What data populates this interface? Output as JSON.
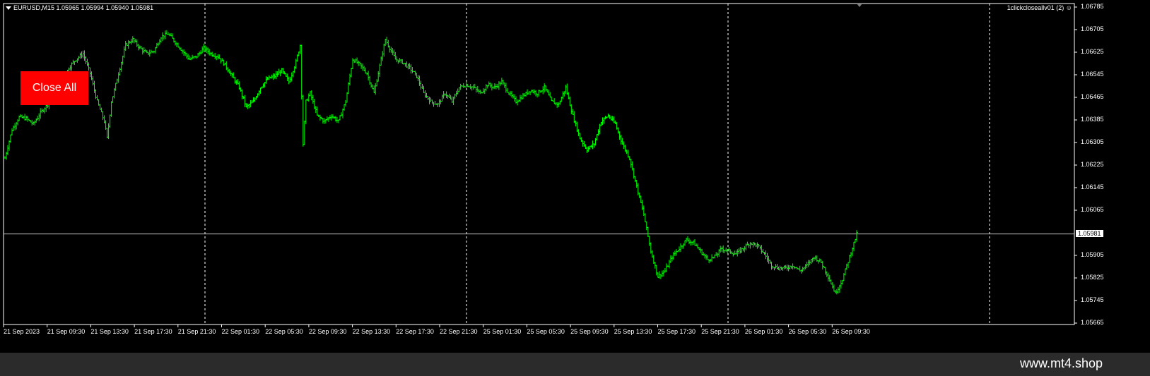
{
  "header": {
    "symbol_info": "EURUSD,M15  1.05965 1.05994 1.05940 1.05981",
    "ea_label": "1clickcloseallv01 (2) ☺"
  },
  "button": {
    "close_all_label": "Close All"
  },
  "price_axis": {
    "labels": [
      "1.06785",
      "1.06705",
      "1.06625",
      "1.06545",
      "1.06465",
      "1.06385",
      "1.06305",
      "1.06225",
      "1.06145",
      "1.06065",
      "1.05905",
      "1.05825",
      "1.05745",
      "1.05665"
    ],
    "current_price": "1.05981"
  },
  "time_axis": {
    "labels": [
      "21 Sep 2023",
      "21 Sep 09:30",
      "21 Sep 13:30",
      "21 Sep 17:30",
      "21 Sep 21:30",
      "22 Sep 01:30",
      "22 Sep 05:30",
      "22 Sep 09:30",
      "22 Sep 13:30",
      "22 Sep 17:30",
      "22 Sep 21:30",
      "25 Sep 01:30",
      "25 Sep 05:30",
      "25 Sep 09:30",
      "25 Sep 13:30",
      "25 Sep 17:30",
      "25 Sep 21:30",
      "26 Sep 01:30",
      "26 Sep 05:30",
      "26 Sep 09:30"
    ]
  },
  "chart_data": {
    "type": "bar",
    "symbol": "EURUSD",
    "timeframe": "M15",
    "ylim": [
      1.05665,
      1.06785
    ],
    "bar_color": "#00ff00",
    "background": "#000000",
    "close_path": [
      [
        0,
        1.0625
      ],
      [
        5,
        1.0635
      ],
      [
        10,
        1.06395
      ],
      [
        15,
        1.0639
      ],
      [
        20,
        1.0637
      ],
      [
        25,
        1.0641
      ],
      [
        30,
        1.0644
      ],
      [
        35,
        1.0648
      ],
      [
        40,
        1.0652
      ],
      [
        45,
        1.0657
      ],
      [
        50,
        1.066
      ],
      [
        55,
        1.0662
      ],
      [
        60,
        1.0655
      ],
      [
        65,
        1.0645
      ],
      [
        70,
        1.0638
      ],
      [
        72,
        1.0632
      ],
      [
        75,
        1.0645
      ],
      [
        80,
        1.0655
      ],
      [
        85,
        1.0665
      ],
      [
        90,
        1.0667
      ],
      [
        95,
        1.0664
      ],
      [
        100,
        1.0662
      ],
      [
        105,
        1.0663
      ],
      [
        110,
        1.0668
      ],
      [
        115,
        1.0669
      ],
      [
        120,
        1.0666
      ],
      [
        125,
        1.0663
      ],
      [
        130,
        1.066
      ],
      [
        135,
        1.0661
      ],
      [
        140,
        1.0664
      ],
      [
        145,
        1.0662
      ],
      [
        150,
        1.0661
      ],
      [
        155,
        1.0658
      ],
      [
        160,
        1.0654
      ],
      [
        165,
        1.065
      ],
      [
        170,
        1.0643
      ],
      [
        175,
        1.0645
      ],
      [
        180,
        1.065
      ],
      [
        185,
        1.0653
      ],
      [
        190,
        1.0654
      ],
      [
        195,
        1.0656
      ],
      [
        200,
        1.0652
      ],
      [
        205,
        1.0659
      ],
      [
        208,
        1.0665
      ],
      [
        210,
        1.063
      ],
      [
        212,
        1.0645
      ],
      [
        215,
        1.0648
      ],
      [
        220,
        1.064
      ],
      [
        225,
        1.0638
      ],
      [
        230,
        1.064
      ],
      [
        235,
        1.0638
      ],
      [
        240,
        1.0645
      ],
      [
        245,
        1.066
      ],
      [
        250,
        1.0658
      ],
      [
        255,
        1.0655
      ],
      [
        260,
        1.0648
      ],
      [
        265,
        1.066
      ],
      [
        268,
        1.0667
      ],
      [
        270,
        1.0665
      ],
      [
        275,
        1.066
      ],
      [
        280,
        1.0659
      ],
      [
        285,
        1.0657
      ],
      [
        290,
        1.0654
      ],
      [
        295,
        1.0648
      ],
      [
        300,
        1.0645
      ],
      [
        305,
        1.0644
      ],
      [
        310,
        1.0648
      ],
      [
        315,
        1.0645
      ],
      [
        320,
        1.065
      ],
      [
        325,
        1.0651
      ],
      [
        330,
        1.065
      ],
      [
        335,
        1.0648
      ],
      [
        340,
        1.0651
      ],
      [
        345,
        1.065
      ],
      [
        350,
        1.0652
      ],
      [
        355,
        1.0648
      ],
      [
        360,
        1.0645
      ],
      [
        365,
        1.0647
      ],
      [
        370,
        1.0649
      ],
      [
        375,
        1.0648
      ],
      [
        380,
        1.065
      ],
      [
        385,
        1.0645
      ],
      [
        390,
        1.0644
      ],
      [
        395,
        1.065
      ],
      [
        400,
        1.064
      ],
      [
        405,
        1.0632
      ],
      [
        410,
        1.0628
      ],
      [
        415,
        1.063
      ],
      [
        420,
        1.0638
      ],
      [
        425,
        1.064
      ],
      [
        430,
        1.0637
      ],
      [
        435,
        1.063
      ],
      [
        440,
        1.0625
      ],
      [
        445,
        1.0615
      ],
      [
        450,
        1.0605
      ],
      [
        455,
        1.0592
      ],
      [
        460,
        1.0583
      ],
      [
        465,
        1.0585
      ],
      [
        470,
        1.059
      ],
      [
        475,
        1.0593
      ],
      [
        480,
        1.0596
      ],
      [
        485,
        1.0595
      ],
      [
        490,
        1.0592
      ],
      [
        495,
        1.0589
      ],
      [
        500,
        1.059
      ],
      [
        505,
        1.0593
      ],
      [
        510,
        1.0592
      ],
      [
        515,
        1.0591
      ],
      [
        520,
        1.0593
      ],
      [
        525,
        1.0595
      ],
      [
        530,
        1.0594
      ],
      [
        535,
        1.0591
      ],
      [
        540,
        1.0587
      ],
      [
        545,
        1.0586
      ],
      [
        550,
        1.0586
      ],
      [
        555,
        1.0587
      ],
      [
        560,
        1.0585
      ],
      [
        565,
        1.0587
      ],
      [
        570,
        1.059
      ],
      [
        575,
        1.0588
      ],
      [
        580,
        1.0583
      ],
      [
        585,
        1.0577
      ],
      [
        590,
        1.0582
      ],
      [
        595,
        1.059
      ],
      [
        600,
        1.0598
      ]
    ]
  },
  "watermark": "www.mt4.shop"
}
